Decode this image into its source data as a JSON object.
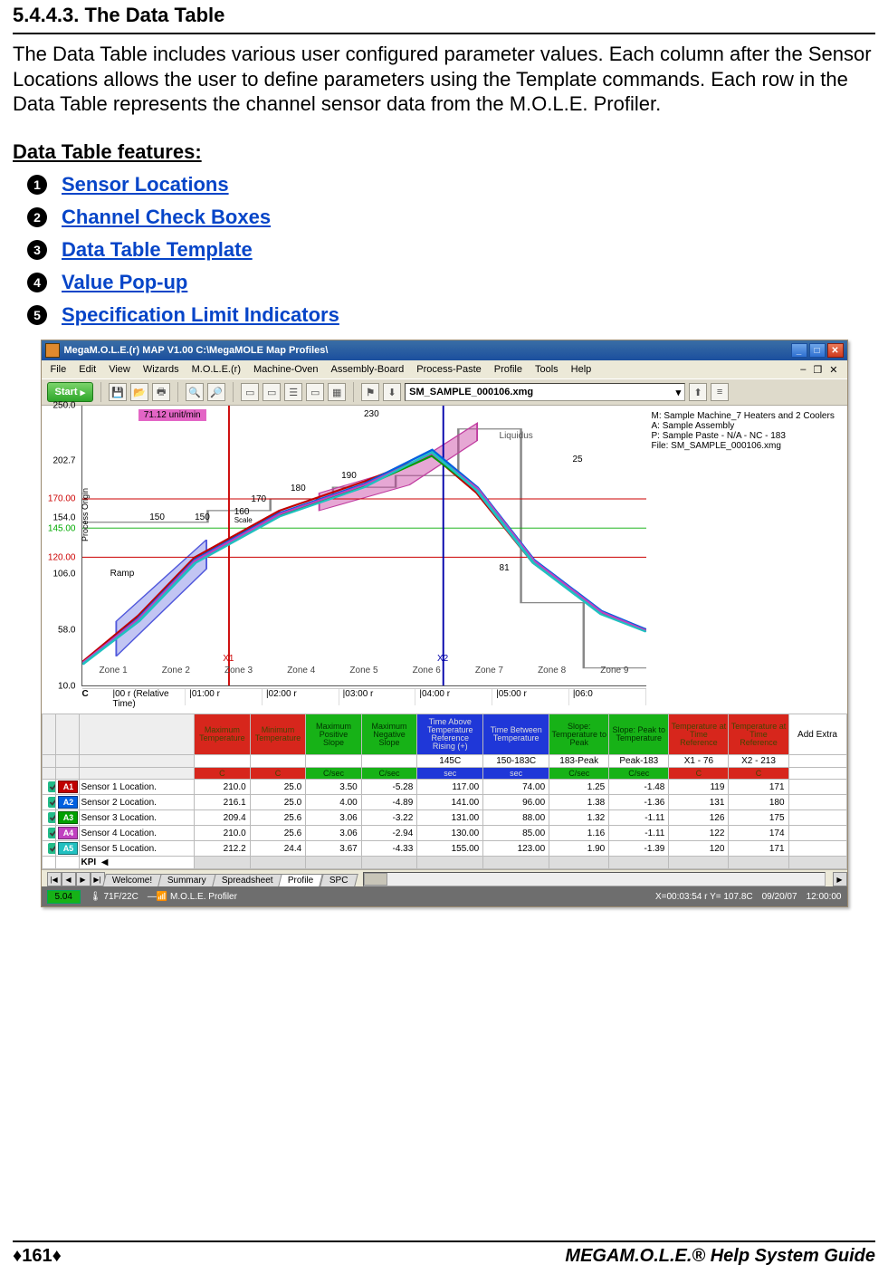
{
  "section_number": "5.4.4.3. The Data Table",
  "body_text": "The Data Table includes various user configured parameter values. Each column after the Sensor Locations allows the user to define parameters using the Template commands. Each row in the Data Table represents the channel sensor data from the M.O.L.E. Profiler.",
  "features_heading": "Data Table features:",
  "features": [
    {
      "n": "1",
      "label": "Sensor Locations"
    },
    {
      "n": "2",
      "label": "Channel Check Boxes"
    },
    {
      "n": "3",
      "label": "Data Table Template"
    },
    {
      "n": "4",
      "label": "Value Pop-up"
    },
    {
      "n": "5",
      "label": "Specification Limit Indicators"
    }
  ],
  "window": {
    "title": "MegaM.O.L.E.(r) MAP V1.00    C:\\MegaMOLE Map Profiles\\",
    "menus": [
      "File",
      "Edit",
      "View",
      "Wizards",
      "M.O.L.E.(r)",
      "Machine-Oven",
      "Assembly-Board",
      "Process-Paste",
      "Profile",
      "Tools",
      "Help"
    ],
    "start": "Start",
    "file_selected": "SM_SAMPLE_000106.xmg",
    "mdi_restore": "❐",
    "mdi_close": "✕"
  },
  "chart_data": {
    "type": "line",
    "ylabel": "",
    "xlabel": "",
    "ylim": [
      10,
      250
    ],
    "y_ticks": [
      {
        "v": 250.0,
        "label": "250.0",
        "color": "#000"
      },
      {
        "v": 202.7,
        "label": "202.7",
        "color": "#000"
      },
      {
        "v": 170.0,
        "label": "170.00",
        "color": "#c00"
      },
      {
        "v": 154.0,
        "label": "154.0",
        "color": "#000"
      },
      {
        "v": 145.0,
        "label": "145.00",
        "color": "#0a0"
      },
      {
        "v": 120.0,
        "label": "120.00",
        "color": "#c00"
      },
      {
        "v": 106.0,
        "label": "106.0",
        "color": "#000"
      },
      {
        "v": 58.0,
        "label": "58.0",
        "color": "#000"
      },
      {
        "v": 10.0,
        "label": "10.0",
        "color": "#000"
      }
    ],
    "zones": [
      "Zone 1",
      "Zone 2",
      "Zone 3",
      "Zone 4",
      "Zone 5",
      "Zone 6",
      "Zone 7",
      "Zone 8",
      "Zone 9"
    ],
    "x_ticks": [
      "C",
      "|00 r (Relative Time)",
      "|01:00 r",
      "|02:00 r",
      "|03:00 r",
      "|04:00 r",
      "|05:00 r",
      "|06:0"
    ],
    "x_range_min": 0,
    "annotations": {
      "slope_label": "71.12 unit/min",
      "ramp": "Ramp",
      "process_origin": "Process Origin",
      "x1": "X1",
      "x2": "X2",
      "scale_160": "160\nScale",
      "v_150a": "150",
      "v_150b": "150",
      "v_170": "170",
      "v_180": "180",
      "v_190": "190",
      "v_230": "230",
      "v_81": "81",
      "v_25": "25",
      "liquidus": "Liquidus"
    },
    "hlines": [
      {
        "y": 170,
        "color": "#c00"
      },
      {
        "y": 145,
        "color": "#0a0"
      },
      {
        "y": 120,
        "color": "#c00"
      }
    ],
    "vlines": [
      {
        "x_frac": 0.26,
        "color": "#c00",
        "label": "X1"
      },
      {
        "x_frac": 0.64,
        "color": "#00a",
        "label": "X2"
      }
    ],
    "series": [
      {
        "name": "Sensor 1",
        "color": "#c00000",
        "x": [
          0,
          0.1,
          0.2,
          0.35,
          0.5,
          0.62,
          0.7,
          0.8,
          0.92,
          1.0
        ],
        "y": [
          30,
          70,
          120,
          160,
          185,
          208,
          175,
          115,
          72,
          58
        ]
      },
      {
        "name": "Sensor 2",
        "color": "#0060e0",
        "x": [
          0,
          0.1,
          0.2,
          0.35,
          0.5,
          0.62,
          0.7,
          0.8,
          0.92,
          1.0
        ],
        "y": [
          28,
          68,
          118,
          158,
          183,
          212,
          180,
          118,
          74,
          58
        ]
      },
      {
        "name": "Sensor 3",
        "color": "#00a000",
        "x": [
          0,
          0.1,
          0.2,
          0.35,
          0.5,
          0.62,
          0.7,
          0.8,
          0.92,
          1.0
        ],
        "y": [
          29,
          66,
          116,
          156,
          181,
          207,
          178,
          116,
          72,
          57
        ]
      },
      {
        "name": "Sensor 4",
        "color": "#c040c0",
        "x": [
          0,
          0.1,
          0.2,
          0.35,
          0.5,
          0.62,
          0.7,
          0.8,
          0.92,
          1.0
        ],
        "y": [
          29,
          67,
          117,
          157,
          182,
          209,
          179,
          117,
          73,
          57
        ]
      },
      {
        "name": "Sensor 5",
        "color": "#20c0c0",
        "x": [
          0,
          0.1,
          0.2,
          0.35,
          0.5,
          0.62,
          0.7,
          0.8,
          0.92,
          1.0
        ],
        "y": [
          28,
          65,
          115,
          155,
          180,
          210,
          177,
          115,
          71,
          56
        ]
      }
    ],
    "info_box": [
      "M: Sample Machine_7 Heaters and 2 Coolers",
      "A: Sample Assembly",
      "P: Sample Paste - N/A - NC - 183",
      "File: SM_SAMPLE_000106.xmg"
    ]
  },
  "data_table": {
    "headers_row1": [
      {
        "cls": "hdr-red",
        "label": "Maximum Temperature"
      },
      {
        "cls": "hdr-red",
        "label": "Minimum Temperature"
      },
      {
        "cls": "hdr-green",
        "label": "Maximum Positive Slope"
      },
      {
        "cls": "hdr-green",
        "label": "Maximum Negative Slope"
      },
      {
        "cls": "hdr-blue",
        "label": "Time Above Temperature Reference Rising (+)"
      },
      {
        "cls": "hdr-blue",
        "label": "Time Between Temperature"
      },
      {
        "cls": "hdr-green",
        "label": "Slope: Temperature to Peak"
      },
      {
        "cls": "hdr-green",
        "label": "Slope: Peak to Temperature"
      },
      {
        "cls": "hdr-red",
        "label": "Temperature at Time Reference"
      },
      {
        "cls": "hdr-red",
        "label": "Temperature at Time Reference"
      },
      {
        "cls": "",
        "label": "Add Extra"
      }
    ],
    "headers_row2": [
      {
        "cls": "",
        "label": ""
      },
      {
        "cls": "",
        "label": ""
      },
      {
        "cls": "",
        "label": ""
      },
      {
        "cls": "",
        "label": ""
      },
      {
        "cls": "",
        "label": "145C"
      },
      {
        "cls": "",
        "label": "150-183C"
      },
      {
        "cls": "",
        "label": "183-Peak"
      },
      {
        "cls": "",
        "label": "Peak-183"
      },
      {
        "cls": "",
        "label": "X1 - 76"
      },
      {
        "cls": "",
        "label": "X2 - 213"
      },
      {
        "cls": "",
        "label": ""
      }
    ],
    "headers_row3": [
      {
        "cls": "sub-red",
        "label": "C"
      },
      {
        "cls": "sub-red",
        "label": "C"
      },
      {
        "cls": "sub-green",
        "label": "C/sec"
      },
      {
        "cls": "sub-green",
        "label": "C/sec"
      },
      {
        "cls": "sub-blue",
        "label": "sec"
      },
      {
        "cls": "sub-blue",
        "label": "sec"
      },
      {
        "cls": "sub-green",
        "label": "C/sec"
      },
      {
        "cls": "sub-green",
        "label": "C/sec"
      },
      {
        "cls": "sub-red",
        "label": "C"
      },
      {
        "cls": "sub-red",
        "label": "C"
      },
      {
        "cls": "",
        "label": ""
      }
    ],
    "rows": [
      {
        "checked": true,
        "badge": "A1",
        "badge_color": "#c00000",
        "loc": "Sensor 1 Location.",
        "vals": [
          "210.0",
          "25.0",
          "3.50",
          "-5.28",
          "117.00",
          "74.00",
          "1.25",
          "-1.48",
          "119",
          "171",
          ""
        ]
      },
      {
        "checked": true,
        "badge": "A2",
        "badge_color": "#0060e0",
        "loc": "Sensor 2 Location.",
        "vals": [
          "216.1",
          "25.0",
          "4.00",
          "-4.89",
          "141.00",
          "96.00",
          "1.38",
          "-1.36",
          "131",
          "180",
          ""
        ]
      },
      {
        "checked": true,
        "badge": "A3",
        "badge_color": "#00a000",
        "loc": "Sensor 3 Location.",
        "vals": [
          "209.4",
          "25.6",
          "3.06",
          "-3.22",
          "131.00",
          "88.00",
          "1.32",
          "-1.11",
          "126",
          "175",
          ""
        ]
      },
      {
        "checked": true,
        "badge": "A4",
        "badge_color": "#c040c0",
        "loc": "Sensor 4 Location.",
        "vals": [
          "210.0",
          "25.6",
          "3.06",
          "-2.94",
          "130.00",
          "85.00",
          "1.16",
          "-1.11",
          "122",
          "174",
          ""
        ]
      },
      {
        "checked": true,
        "badge": "A5",
        "badge_color": "#20c0c0",
        "loc": "Sensor 5 Location.",
        "vals": [
          "212.2",
          "24.4",
          "3.67",
          "-4.33",
          "155.00",
          "123.00",
          "1.90",
          "-1.39",
          "120",
          "171",
          ""
        ]
      }
    ],
    "kpi_label": "KPI"
  },
  "sheet_tabs": {
    "nav": [
      "|◀",
      "◀",
      "▶",
      "▶|"
    ],
    "tabs": [
      {
        "label": "Welcome!",
        "active": false
      },
      {
        "label": "Summary",
        "active": false
      },
      {
        "label": "Spreadsheet",
        "active": false
      },
      {
        "label": "Profile",
        "active": true
      },
      {
        "label": "SPC",
        "active": false
      }
    ]
  },
  "statusbar": {
    "val1": "5.04",
    "val2": "71F/22C",
    "val3": "M.O.L.E. Profiler",
    "coords": "X=00:03:54 r Y= 107.8C",
    "date": "09/20/07",
    "time": "12:00:00"
  },
  "footer": {
    "page": "♦161♦",
    "right_prefix": "MEGA",
    "right_rest": "M.O.L.E.® Help System Guide"
  }
}
